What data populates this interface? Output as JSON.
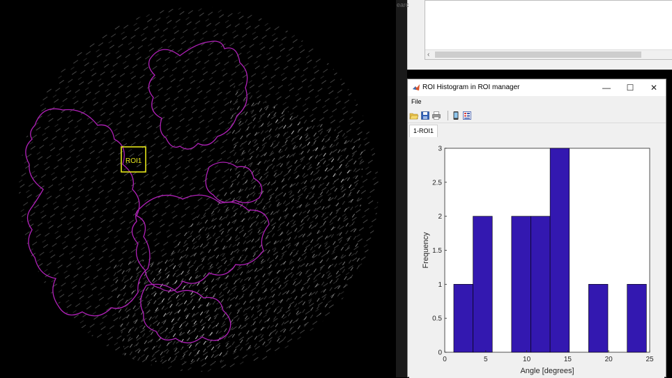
{
  "image_view": {
    "roi_label": "ROI1",
    "roi_color": "#e6e619",
    "outline_color": "#b020b8"
  },
  "background_window": {
    "edge_text": "earc",
    "scroll_left_glyph": "‹"
  },
  "histogram_window": {
    "title": "ROI Histogram in ROI manager",
    "controls": {
      "minimize": "—",
      "maximize": "☐",
      "close": "✕"
    },
    "menu": [
      "File"
    ],
    "toolbar_icons": [
      "open-folder-icon",
      "save-icon",
      "print-icon",
      "phone-icon",
      "property-inspector-icon"
    ],
    "tabs": [
      "1-ROI1"
    ]
  },
  "chart_data": {
    "type": "bar",
    "title": "",
    "xlabel": "Angle [degrees]",
    "ylabel": "Frequency",
    "xlim": [
      0,
      25
    ],
    "ylim": [
      0,
      3
    ],
    "xticks": [
      "0",
      "5",
      "10",
      "15",
      "20",
      "25"
    ],
    "yticks": [
      "0",
      "0.5",
      "1",
      "1.5",
      "2",
      "2.5",
      "3"
    ],
    "grid": false,
    "bar_color": "#3318b0",
    "bins": [
      {
        "from": 1.1,
        "to": 3.45,
        "value": 1
      },
      {
        "from": 3.45,
        "to": 5.8,
        "value": 2
      },
      {
        "from": 8.15,
        "to": 10.5,
        "value": 2
      },
      {
        "from": 10.5,
        "to": 12.85,
        "value": 2
      },
      {
        "from": 12.85,
        "to": 15.2,
        "value": 3
      },
      {
        "from": 17.55,
        "to": 19.9,
        "value": 1
      },
      {
        "from": 22.25,
        "to": 24.6,
        "value": 1
      }
    ]
  }
}
